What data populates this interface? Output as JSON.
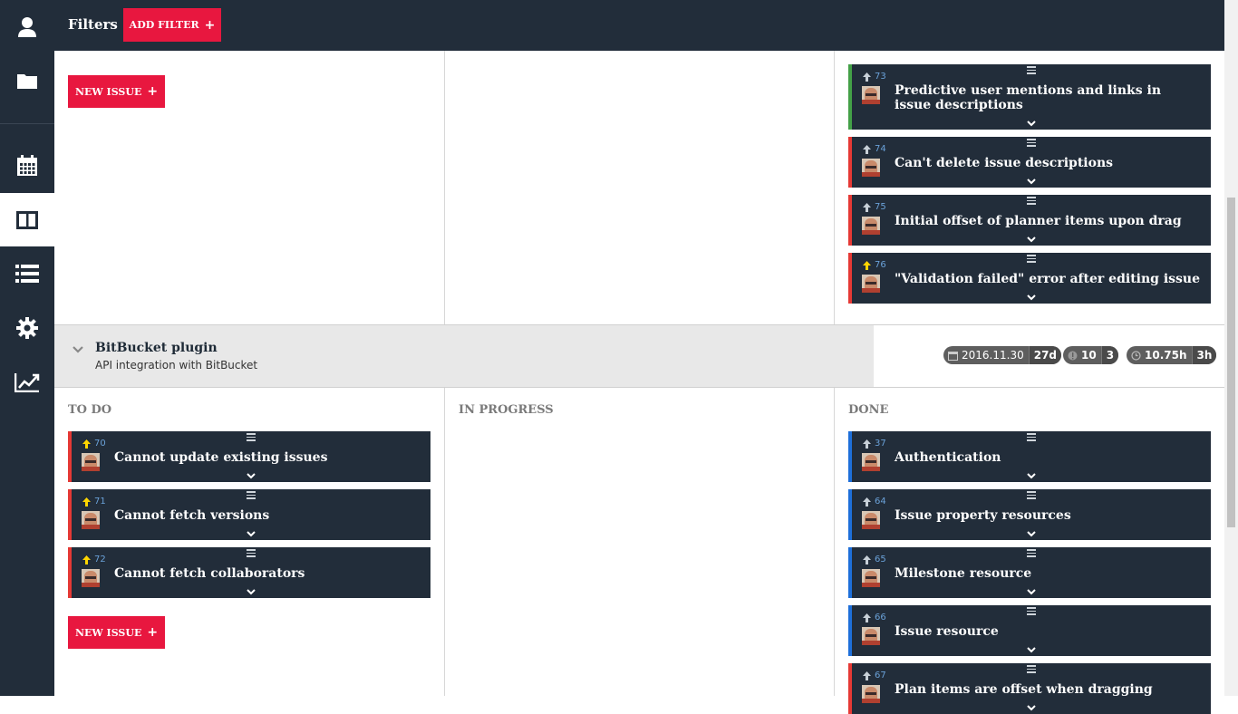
{
  "topbar": {
    "title": "Filters",
    "add_filter_label": "ADD FILTER"
  },
  "sidebar": {
    "items": [
      {
        "name": "user-icon",
        "active": false
      },
      {
        "name": "folder-icon",
        "active": false
      },
      {
        "name": "calendar-icon",
        "active": false
      },
      {
        "name": "board-icon",
        "active": true
      },
      {
        "name": "list-icon",
        "active": false
      },
      {
        "name": "gear-icon",
        "active": false
      },
      {
        "name": "chart-icon",
        "active": false
      }
    ]
  },
  "new_issue_label": "NEW ISSUE",
  "top_done_cards": [
    {
      "number": "73",
      "title": "Predictive user mentions and links in issue descriptions",
      "priority_color": "#c7d0d8",
      "border": "#43a047"
    },
    {
      "number": "74",
      "title": "Can't delete issue descriptions",
      "priority_color": "#c7d0d8",
      "border": "#e53935"
    },
    {
      "number": "75",
      "title": "Initial offset of planner items upon drag",
      "priority_color": "#c7d0d8",
      "border": "#e53935"
    },
    {
      "number": "76",
      "title": "\"Validation failed\" error after editing issue",
      "priority_color": "#ffd600",
      "border": "#e53935"
    }
  ],
  "milestone": {
    "name": "BitBucket plugin",
    "description": "API integration with BitBucket",
    "due_date": "2016.11.30",
    "days_left": "27d",
    "issues_total": "10",
    "issues_open": "3",
    "time_spent": "10.75h",
    "time_remaining": "3h"
  },
  "columns": {
    "todo": "TO DO",
    "in_progress": "IN PROGRESS",
    "done": "DONE"
  },
  "todo_cards": [
    {
      "number": "70",
      "title": "Cannot update existing issues",
      "priority_color": "#ffd600",
      "border": "#e53935"
    },
    {
      "number": "71",
      "title": "Cannot fetch versions",
      "priority_color": "#ffd600",
      "border": "#e53935"
    },
    {
      "number": "72",
      "title": "Cannot fetch collaborators",
      "priority_color": "#ffd600",
      "border": "#e53935"
    }
  ],
  "done_cards": [
    {
      "number": "37",
      "title": "Authentication",
      "priority_color": "#c7d0d8",
      "border": "#1e6fd9"
    },
    {
      "number": "64",
      "title": "Issue property resources",
      "priority_color": "#c7d0d8",
      "border": "#1e6fd9"
    },
    {
      "number": "65",
      "title": "Milestone resource",
      "priority_color": "#c7d0d8",
      "border": "#1e6fd9"
    },
    {
      "number": "66",
      "title": "Issue resource",
      "priority_color": "#c7d0d8",
      "border": "#1e6fd9"
    },
    {
      "number": "67",
      "title": "Plan items are offset when dragging",
      "priority_color": "#c7d0d8",
      "border": "#e53935"
    }
  ]
}
